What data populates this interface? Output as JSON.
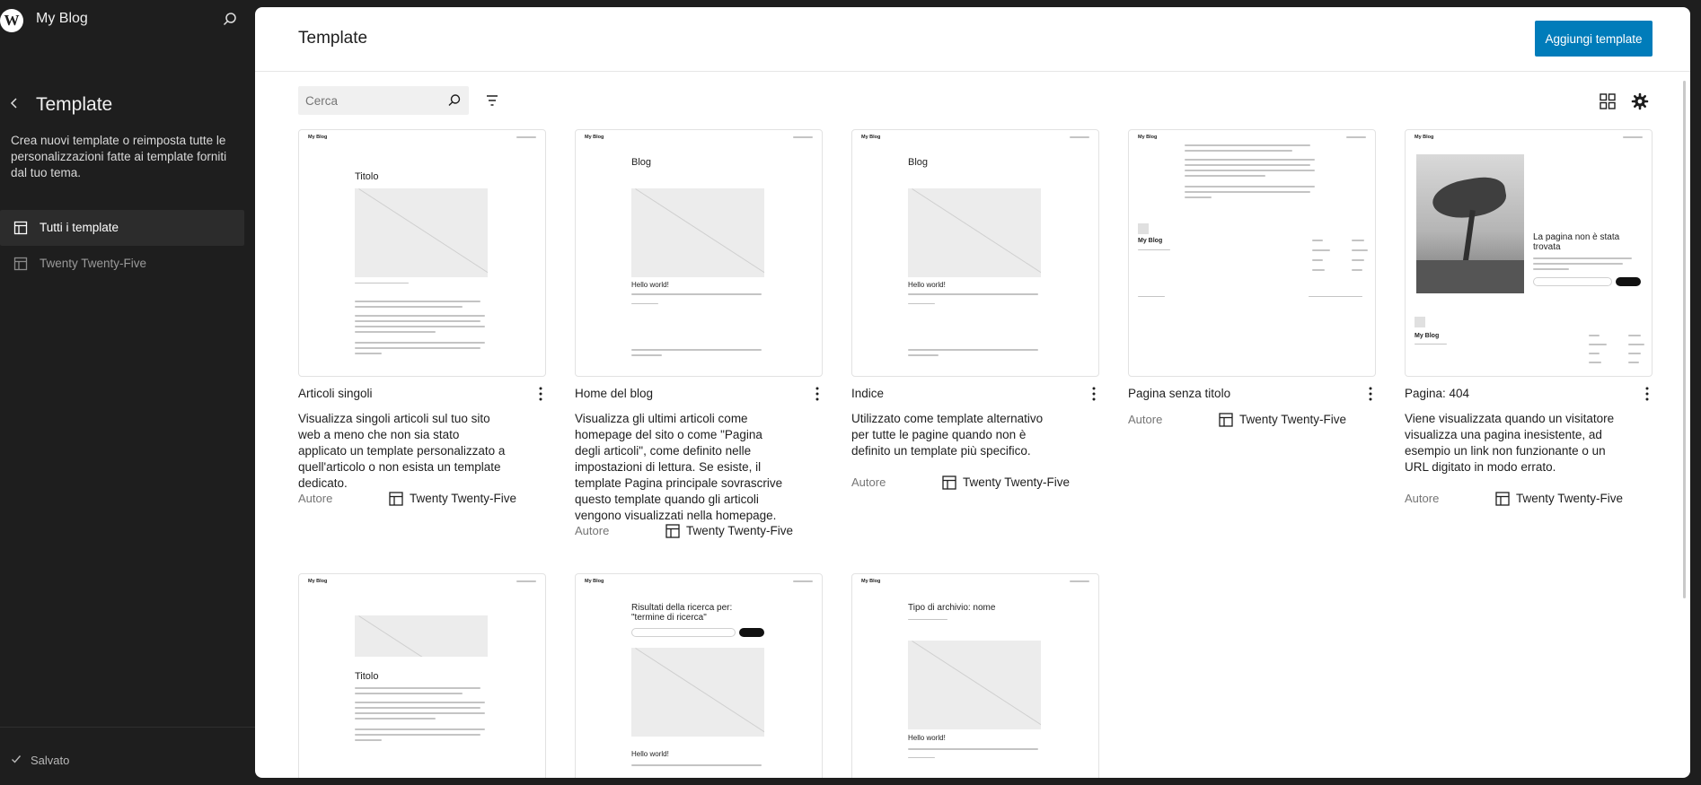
{
  "site": {
    "title": "My Blog"
  },
  "sidebar": {
    "title": "Template",
    "description": "Crea nuovi template o reimposta tutte le personalizzazioni fatte ai template forniti dal tuo tema.",
    "items": [
      {
        "label": "Tutti i template",
        "active": true
      },
      {
        "label": "Twenty Twenty-Five",
        "active": false
      }
    ],
    "status": "Salvato"
  },
  "header": {
    "title": "Template",
    "add_button": "Aggiungi template"
  },
  "toolbar": {
    "search_placeholder": "Cerca"
  },
  "templates": [
    {
      "title": "Articoli singoli",
      "description": "Visualizza singoli articoli sul tuo sito web a meno che non sia stato applicato un template personalizzato a quell'articolo o non esista un template dedicato.",
      "author_label": "Autore",
      "theme": "Twenty Twenty-Five",
      "preview": {
        "site": "My Blog",
        "heading": "Titolo"
      }
    },
    {
      "title": "Home del blog",
      "description": "Visualizza gli ultimi articoli come homepage del sito o come \"Pagina degli articoli\", come definito nelle impostazioni di lettura. Se esiste, il template Pagina principale sovrascrive questo template quando gli articoli vengono visualizzati nella homepage.",
      "author_label": "Autore",
      "theme": "Twenty Twenty-Five",
      "preview": {
        "site": "My Blog",
        "heading": "Blog",
        "post": "Hello world!"
      }
    },
    {
      "title": "Indice",
      "description": "Utilizzato come template alternativo per tutte le pagine quando non è definito un template più specifico.",
      "author_label": "Autore",
      "theme": "Twenty Twenty-Five",
      "preview": {
        "site": "My Blog",
        "heading": "Blog",
        "post": "Hello world!"
      }
    },
    {
      "title": "Pagina senza titolo",
      "description": "",
      "author_label": "Autore",
      "theme": "Twenty Twenty-Five",
      "preview": {
        "site": "My Blog"
      }
    },
    {
      "title": "Pagina: 404",
      "description": "Viene visualizzata quando un visitatore visualizza una pagina inesistente, ad esempio un link non funzionante o un URL digitato in modo errato.",
      "author_label": "Autore",
      "theme": "Twenty Twenty-Five",
      "preview": {
        "site": "My Blog",
        "heading": "La pagina non è stata trovata"
      }
    },
    {
      "preview": {
        "site": "My Blog",
        "heading": "Titolo"
      }
    },
    {
      "preview": {
        "site": "My Blog",
        "heading": "Risultati della ricerca per: \"termine di ricerca\"",
        "post": "Hello world!"
      }
    },
    {
      "preview": {
        "site": "My Blog",
        "heading": "Tipo di archivio: nome",
        "post": "Hello world!"
      }
    }
  ]
}
